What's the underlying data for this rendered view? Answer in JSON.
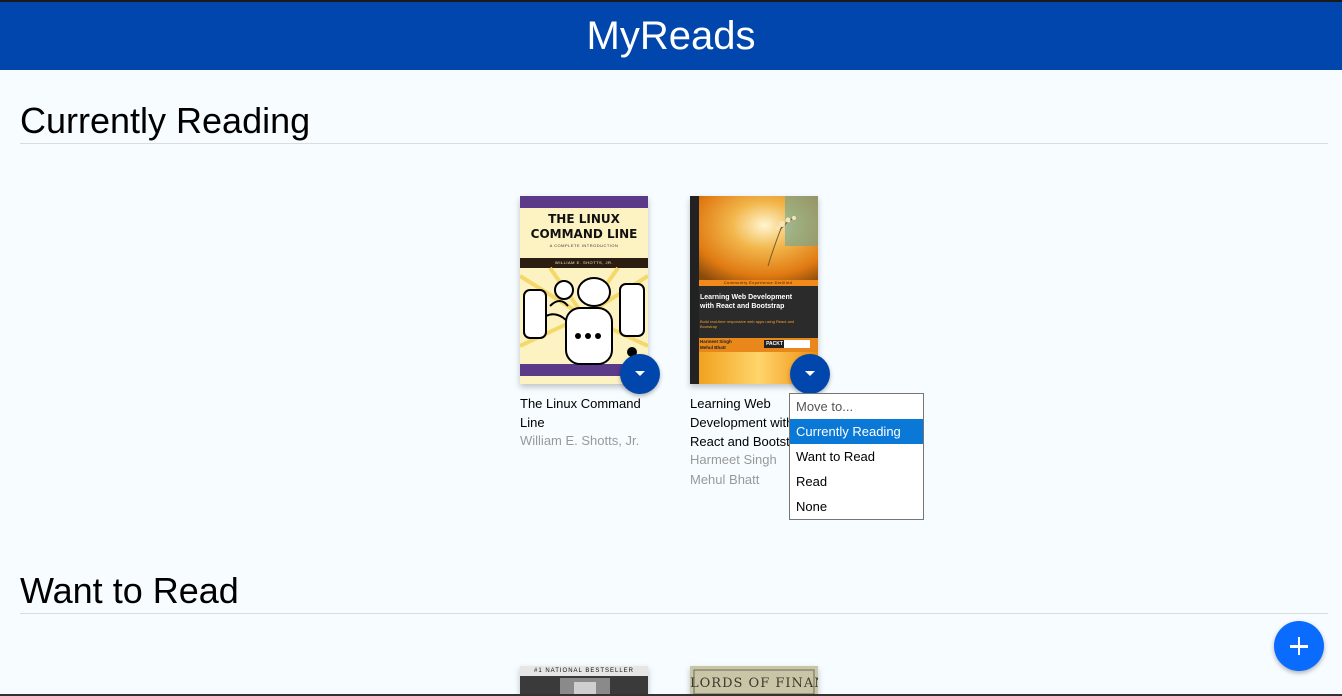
{
  "app": {
    "title": "MyReads"
  },
  "shelves": [
    {
      "title": "Currently Reading",
      "books": [
        {
          "title": "The Linux Command Line",
          "authors": [
            "William E. Shotts, Jr."
          ],
          "cover": {
            "title_line1": "THE LINUX",
            "title_line2": "COMMAND LINE",
            "subtitle": "A COMPLETE INTRODUCTION",
            "author": "WILLIAM E. SHOTTS, JR."
          }
        },
        {
          "title": "Learning Web Development with React and Bootstrap",
          "authors": [
            "Harmeet Singh",
            "Mehul Bhatt"
          ],
          "cover": {
            "series": "Community Experience Distilled",
            "title_line1": "Learning Web Development",
            "title_line2": "with React and Bootstrap",
            "tagline": "Build real-time responsive web apps using React and Bootstrap",
            "author1": "Harmeet Singh",
            "author2": "Mehul Bhatt",
            "publisher": "PACKT"
          }
        }
      ]
    },
    {
      "title": "Want to Read",
      "books": [
        {
          "cover": {
            "banner": "#1 NATIONAL BESTSELLER"
          }
        },
        {
          "cover": {
            "title": "LORDS OF FINANCE"
          }
        }
      ]
    }
  ],
  "shelf_menu": {
    "header": "Move to...",
    "options": [
      "Currently Reading",
      "Want to Read",
      "Read",
      "None"
    ],
    "selected": "Currently Reading"
  },
  "colors": {
    "header_bg": "#0046ad",
    "page_bg": "#f6fcff",
    "changer_bg": "#0046ad",
    "add_button_bg": "#0a6cff",
    "menu_selected": "#0a78d7"
  },
  "icons": {
    "shelf_changer": "caret-down-icon",
    "add_book": "plus-icon"
  }
}
